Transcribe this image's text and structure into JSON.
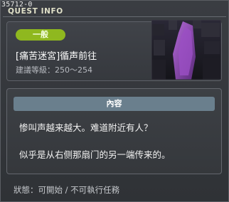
{
  "window": {
    "id_label": "35712-0",
    "title": "QUEST INFO"
  },
  "quest": {
    "category_badge": "一般",
    "name": "[痛苦迷宮]循声前往",
    "level_requirement": "建議等級：250～254",
    "thumbnail_icon": "dark-portal-thumbnail"
  },
  "content": {
    "header": "內容",
    "lines": [
      "惨叫声越来越大。难道附近有人？",
      "似乎是从右侧那扇门的另一端传来的。"
    ]
  },
  "status": {
    "text": "狀態：可開始 / 不可執行任務"
  },
  "colors": {
    "badge_green": "#8fb81f",
    "header_blue": "#6a7f8d",
    "title_text": "#e0e0c8"
  }
}
